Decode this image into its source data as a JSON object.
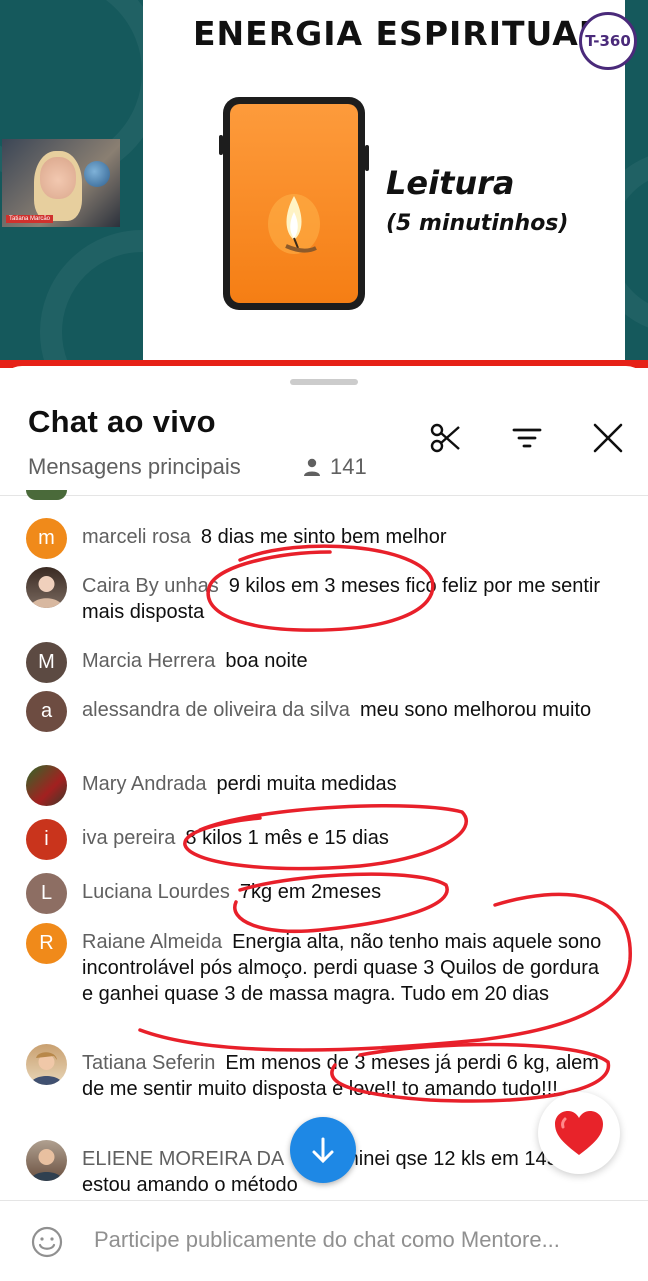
{
  "video": {
    "slide_title": "ENERGIA ESPIRITUAL",
    "logo_text": "T-360",
    "reading_title": "Leitura",
    "reading_duration": "(5 minutinhos)",
    "presenter_name": "Tatiana Marcão"
  },
  "chat": {
    "title": "Chat ao vivo",
    "subtitle": "Mensagens principais",
    "viewer_count": "141",
    "messages": [
      {
        "author": "marceli rosa",
        "text": "8 dias me sinto bem melhor",
        "avatar_letter": "m",
        "avatar_color": "#f08a1a"
      },
      {
        "author": "Caira By unhas",
        "text": "9 kilos em 3 meses fico feliz por me sentir mais disposta",
        "avatar_letter": "",
        "avatar_color": "#5a4a42"
      },
      {
        "author": "Marcia Herrera",
        "text": "boa noite",
        "avatar_letter": "M",
        "avatar_color": "#5c4a42"
      },
      {
        "author": "alessandra de oliveira da silva",
        "text": "meu sono melhorou muito",
        "avatar_letter": "a",
        "avatar_color": "#6d4c41"
      },
      {
        "author": "Mary Andrada",
        "text": "perdi muita medidas",
        "avatar_letter": "",
        "avatar_color": "#3a5a2a"
      },
      {
        "author": "iva pereira",
        "text": "8 kilos 1 mês e 15 dias",
        "avatar_letter": "i",
        "avatar_color": "#c9341c"
      },
      {
        "author": "Luciana Lourdes",
        "text": "7kg em 2meses",
        "avatar_letter": "L",
        "avatar_color": "#8d6e63"
      },
      {
        "author": "Raiane Almeida",
        "text": "Energia alta, não tenho mais aquele sono incontrolável pós almoço. perdi quase 3 Quilos de gordura e ganhei quase 3 de massa magra. Tudo em 20 dias",
        "avatar_letter": "R",
        "avatar_color": "#f08a1a"
      },
      {
        "author": "Tatiana Seferin",
        "text": "Em menos de 3 meses já perdi 6 kg, alem de me sentir muito disposta e leve!! to amando tudo!!!",
        "avatar_letter": "",
        "avatar_color": "#c9a070"
      },
      {
        "author": "ELIENE MOREIRA DA",
        "text": "eu eliminei qse 12 kls em 145 dias estou amando o método",
        "avatar_letter": "",
        "avatar_color": "#7a6050"
      }
    ],
    "input_placeholder": "Participe publicamente do chat como Mentore..."
  },
  "icons": [
    "scissors-icon",
    "filter-icon",
    "close-icon",
    "person-icon",
    "arrow-down-icon",
    "heart-icon",
    "emoji-icon",
    "candle-icon"
  ],
  "colors": {
    "accent_red": "#e62117",
    "scroll_blue": "#1e88e5",
    "teal_bg": "#15595c",
    "phone_orange": "#f57e14",
    "annotation_red": "#e8202a"
  }
}
